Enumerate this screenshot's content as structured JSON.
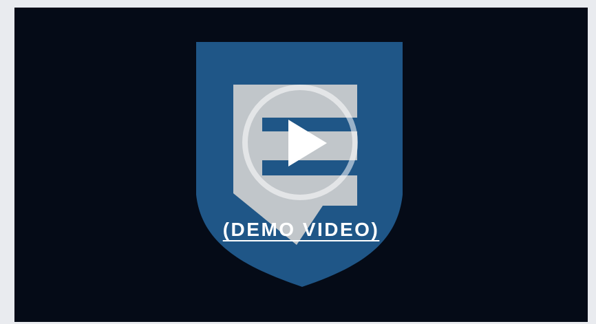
{
  "video": {
    "link_label": "(DEMO VIDEO)",
    "logo_icon": "shield-e-logo-icon",
    "play_icon": "play-icon"
  },
  "colors": {
    "background": "#050b17",
    "page": "#e9ebef",
    "shield": "#1f5687",
    "logo_letter": "#cfcfcf",
    "text": "#ffffff"
  }
}
